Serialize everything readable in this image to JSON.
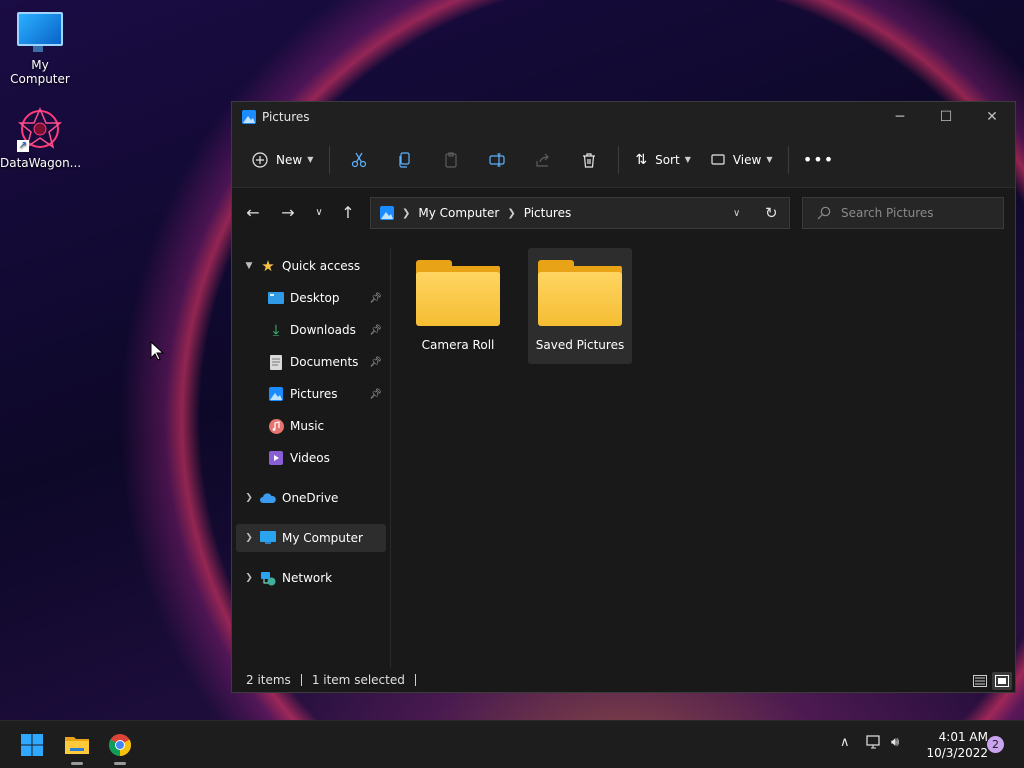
{
  "desktop": {
    "icons": [
      {
        "label": "My Computer",
        "icon": "monitor-icon"
      },
      {
        "label": "DataWagon...",
        "icon": "datawagon-icon"
      }
    ]
  },
  "window": {
    "title": "Pictures",
    "toolbar": {
      "new_label": "New",
      "sort_label": "Sort",
      "view_label": "View",
      "icons": [
        "cut-icon",
        "copy-icon",
        "paste-icon",
        "rename-icon",
        "share-icon",
        "delete-icon",
        "more-icon"
      ]
    },
    "address": {
      "crumbs": [
        "My Computer",
        "Pictures"
      ]
    },
    "search": {
      "placeholder": "Search Pictures"
    },
    "sidebar": {
      "quick_access": "Quick access",
      "items": [
        {
          "label": "Desktop",
          "icon": "desktop-icon",
          "pinned": true
        },
        {
          "label": "Downloads",
          "icon": "downloads-icon",
          "pinned": true
        },
        {
          "label": "Documents",
          "icon": "documents-icon",
          "pinned": true
        },
        {
          "label": "Pictures",
          "icon": "pictures-icon",
          "pinned": true
        },
        {
          "label": "Music",
          "icon": "music-icon",
          "pinned": false
        },
        {
          "label": "Videos",
          "icon": "videos-icon",
          "pinned": false
        }
      ],
      "onedrive": "OneDrive",
      "my_computer": "My Computer",
      "network": "Network"
    },
    "content": {
      "folders": [
        {
          "label": "Camera Roll",
          "selected": false
        },
        {
          "label": "Saved Pictures",
          "selected": true
        }
      ]
    },
    "status": {
      "items_count": "2 items",
      "selected": "1 item selected"
    }
  },
  "taskbar": {
    "time": "4:01 AM",
    "date": "10/3/2022",
    "notification_count": "2",
    "apps": [
      "start-icon",
      "file-explorer-icon",
      "chrome-icon"
    ]
  },
  "colors": {
    "window_bg": "#191919",
    "toolbar_bg": "#202020",
    "folder_yellow": "#f5bd32",
    "accent_blue": "#1a8cff"
  }
}
